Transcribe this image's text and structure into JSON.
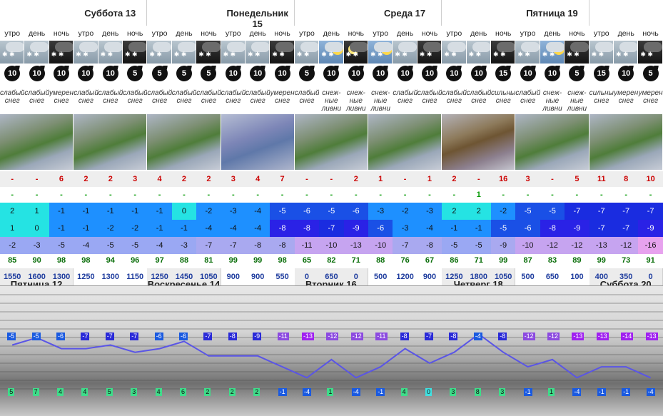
{
  "days": [
    {
      "name": "Пятница 12"
    },
    {
      "name": "Суббота 13"
    },
    {
      "name": "Воскресенье 14"
    },
    {
      "name": "Понедельник 15"
    },
    {
      "name": "Вторник 16"
    },
    {
      "name": "Среда 17"
    },
    {
      "name": "Четверг 18"
    },
    {
      "name": "Пятница 19"
    },
    {
      "name": "Суббота 20"
    }
  ],
  "periods": [
    "утро",
    "день",
    "ночь"
  ],
  "wind": [
    "10",
    "10",
    "10",
    "10",
    "10",
    "5",
    "5",
    "5",
    "5",
    "10",
    "10",
    "10",
    "5",
    "10",
    "10",
    "10",
    "10",
    "10",
    "10",
    "10",
    "15",
    "10",
    "10",
    "5",
    "15",
    "10",
    "5"
  ],
  "descriptions": [
    "слабый снег",
    "слабый снег",
    "умерен снег",
    "слабый снег",
    "слабый снег",
    "слабый снег",
    "слабый снег",
    "слабый снег",
    "слабый снег",
    "слабый снег",
    "слабый снег",
    "умерен снег",
    "слабый снег",
    "снеж-ные ливни",
    "снеж-ные ливни",
    "снеж-ные ливни",
    "слабый снег",
    "слабый снег",
    "слабый снег",
    "слабый снег",
    "сильный снег",
    "слабый снег",
    "снеж-ные ливни",
    "снеж-ные ливни",
    "сильный снег",
    "умерен снег",
    "умерен снег"
  ],
  "precip": [
    "-",
    "-",
    "6",
    "2",
    "2",
    "3",
    "4",
    "2",
    "2",
    "3",
    "4",
    "7",
    "-",
    "-",
    "2",
    "1",
    "-",
    "1",
    "2",
    "-",
    "16",
    "3",
    "-",
    "5",
    "11",
    "8",
    "10"
  ],
  "snow": [
    "-",
    "-",
    "-",
    "-",
    "-",
    "-",
    "-",
    "-",
    "-",
    "-",
    "-",
    "-",
    "-",
    "-",
    "-",
    "-",
    "-",
    "-",
    "-",
    "1",
    "-",
    "-",
    "-",
    "-",
    "-",
    "-",
    "-"
  ],
  "temp1": [
    "2",
    "1",
    "-1",
    "-1",
    "-1",
    "-1",
    "-1",
    "0",
    "-2",
    "-3",
    "-4",
    "-5",
    "-6",
    "-5",
    "-6",
    "-3",
    "-2",
    "-3",
    "2",
    "2",
    "-2",
    "-5",
    "-5",
    "-7",
    "-7",
    "-7",
    "-7"
  ],
  "temp2": [
    "1",
    "0",
    "-1",
    "-1",
    "-2",
    "-2",
    "-1",
    "-1",
    "-4",
    "-4",
    "-4",
    "-8",
    "-8",
    "-7",
    "-9",
    "-6",
    "-3",
    "-4",
    "-1",
    "-1",
    "-5",
    "-6",
    "-8",
    "-9",
    "-7",
    "-7",
    "-9"
  ],
  "temp3": [
    "-2",
    "-3",
    "-5",
    "-4",
    "-5",
    "-5",
    "-4",
    "-3",
    "-7",
    "-7",
    "-8",
    "-8",
    "-11",
    "-10",
    "-13",
    "-10",
    "-7",
    "-8",
    "-5",
    "-5",
    "-9",
    "-10",
    "-12",
    "-12",
    "-13",
    "-12",
    "-16"
  ],
  "humidity": [
    "85",
    "90",
    "98",
    "98",
    "94",
    "96",
    "97",
    "88",
    "81",
    "99",
    "99",
    "98",
    "65",
    "82",
    "71",
    "88",
    "76",
    "67",
    "86",
    "71",
    "99",
    "87",
    "83",
    "89",
    "99",
    "73",
    "91"
  ],
  "altitude": [
    "1550",
    "1600",
    "1300",
    "1250",
    "1300",
    "1150",
    "1250",
    "1450",
    "1050",
    "900",
    "900",
    "550",
    "0",
    "650",
    "0",
    "500",
    "1200",
    "900",
    "1250",
    "1800",
    "1050",
    "500",
    "650",
    "100",
    "400",
    "350",
    "0"
  ],
  "chart_data": {
    "type": "line",
    "upper_labels": [
      "-5",
      "-5",
      "-6",
      "-7",
      "-7",
      "-7",
      "-6",
      "-6",
      "-7",
      "-8",
      "-9",
      "-11",
      "-13",
      "-12",
      "-12",
      "-11",
      "-8",
      "-7",
      "-8",
      "-4",
      "-8",
      "-12",
      "-12",
      "-13",
      "-13",
      "-14",
      "-13"
    ],
    "lower_labels": [
      "5",
      "7",
      "4",
      "4",
      "5",
      "3",
      "4",
      "6",
      "2",
      "2",
      "2",
      "-1",
      "-4",
      "1",
      "-4",
      "-1",
      "4",
      "0",
      "3",
      "8",
      "3",
      "-1",
      "1",
      "-4",
      "-1",
      "-1",
      "-4"
    ],
    "series": [
      {
        "values": [
          5,
          7,
          4,
          4,
          5,
          3,
          4,
          6,
          2,
          2,
          2,
          -1,
          -4,
          1,
          -4,
          -1,
          4,
          0,
          3,
          8,
          3,
          -1,
          1,
          -4,
          -1,
          -1,
          -4
        ]
      }
    ],
    "colors": {
      "line": "#5a55e6",
      "pos": "#3fdc8a",
      "zero": "#40e0e0",
      "neg_blue": "#1a5ae0",
      "neg_violet": "#8c4ae0",
      "neg_purple": "#a020f0"
    }
  }
}
